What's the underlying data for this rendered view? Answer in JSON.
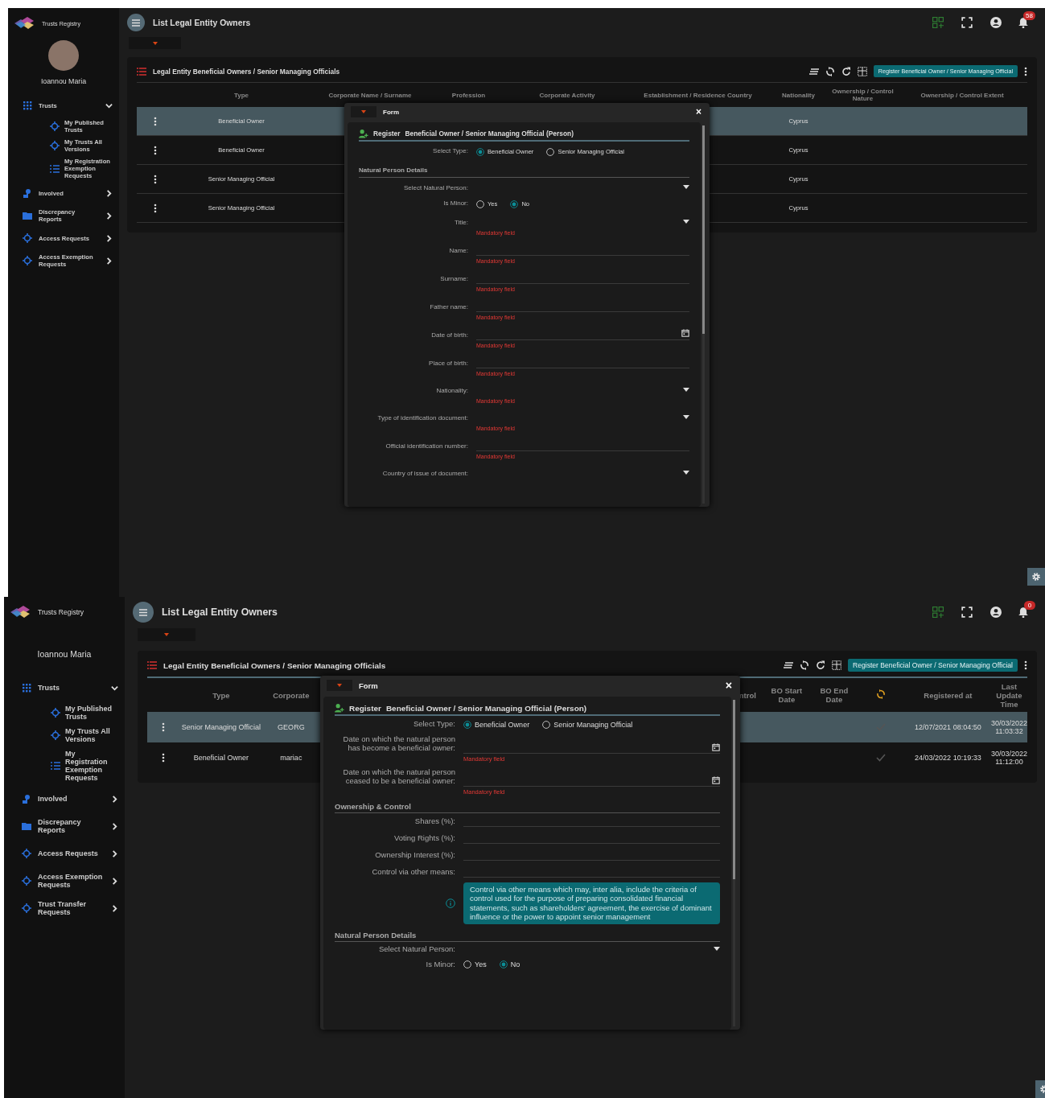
{
  "screens": [
    {
      "app_name": "Trusts Registry",
      "avatar": true,
      "user_name": "Ioannou Maria",
      "page_title": "List Legal Entity Owners",
      "notification_count": "58",
      "nav": [
        {
          "label": "Trusts",
          "kind": "grid",
          "expanded": true,
          "children": [
            {
              "label": "My Published Trusts",
              "kind": "target"
            },
            {
              "label": "My Trusts All Versions",
              "kind": "target"
            },
            {
              "label": "My Registration Exemption Requests",
              "kind": "list"
            }
          ]
        },
        {
          "label": "Involved",
          "kind": "person",
          "expanded": false
        },
        {
          "label": "Discrepancy Reports",
          "kind": "folder",
          "expanded": false
        },
        {
          "label": "Access Requests",
          "kind": "target",
          "expanded": false
        },
        {
          "label": "Access Exemption Requests",
          "kind": "target",
          "expanded": false
        }
      ],
      "table": {
        "title": "Legal Entity Beneficial Owners / Senior Managing Officials",
        "button": "Register Beneficial Owner / Senior Managing Official",
        "columns": [
          {
            "kind": "text",
            "label": "Type"
          },
          {
            "kind": "text",
            "label": "Corporate Name / Surname"
          },
          {
            "kind": "text",
            "label": "Profession"
          },
          {
            "kind": "text",
            "label": "Corporate Activity"
          },
          {
            "kind": "text",
            "label": "Establishment / Residence Country"
          },
          {
            "kind": "text",
            "label": "Nationality"
          },
          {
            "kind": "text",
            "label": "Ownership / Control Nature"
          },
          {
            "kind": "text",
            "label": "Ownership / Control Extent"
          }
        ],
        "rows": [
          {
            "selected": true,
            "cells": [
              "Beneficial Owner",
              null,
              null,
              null,
              null,
              "Cyprus",
              null,
              null
            ]
          },
          {
            "selected": false,
            "cells": [
              "Beneficial Owner",
              null,
              null,
              null,
              null,
              "Cyprus",
              null,
              null
            ]
          },
          {
            "selected": false,
            "cells": [
              "Senior Managing Official",
              null,
              null,
              null,
              null,
              "Cyprus",
              null,
              null
            ]
          },
          {
            "selected": false,
            "cells": [
              "Senior Managing Official",
              null,
              null,
              null,
              null,
              "Cyprus",
              null,
              null
            ]
          }
        ]
      },
      "form": {
        "title": "Form",
        "close": "×",
        "heading_prefix": "Register",
        "heading": "Beneficial Owner / Senior Managing Official (Person)",
        "fields": [
          {
            "kind": "radio",
            "label": "Select Type:",
            "options": [
              {
                "label": "Beneficial Owner",
                "selected": true
              },
              {
                "label": "Senior Managing Official",
                "selected": false
              }
            ]
          },
          {
            "kind": "section",
            "label": "Natural Person Details"
          },
          {
            "kind": "select",
            "label": "Select Natural Person:"
          },
          {
            "kind": "radio",
            "label": "Is Minor:",
            "options": [
              {
                "label": "Yes",
                "selected": false
              },
              {
                "label": "No",
                "selected": true
              }
            ]
          },
          {
            "kind": "select",
            "label": "Title:",
            "error": "Mandatory field"
          },
          {
            "kind": "text",
            "label": "Name:",
            "error": "Mandatory field"
          },
          {
            "kind": "text",
            "label": "Surname:",
            "error": "Mandatory field"
          },
          {
            "kind": "text",
            "label": "Father name:",
            "error": "Mandatory field"
          },
          {
            "kind": "date",
            "label": "Date of birth:",
            "error": "Mandatory field"
          },
          {
            "kind": "text",
            "label": "Place of birth:",
            "error": "Mandatory field"
          },
          {
            "kind": "select",
            "label": "Nationality:",
            "error": "Mandatory field"
          },
          {
            "kind": "select",
            "label": "Type of identification document:",
            "error": "Mandatory field"
          },
          {
            "kind": "text",
            "label": "Official identification number:",
            "error": "Mandatory field"
          },
          {
            "kind": "select",
            "label": "Country of issue of document:"
          }
        ]
      }
    },
    {
      "app_name": "Trusts Registry",
      "avatar": false,
      "user_name": "Ioannou Maria",
      "page_title": "List Legal Entity Owners",
      "notification_count": "0",
      "nav": [
        {
          "label": "Trusts",
          "kind": "grid",
          "expanded": true,
          "children": [
            {
              "label": "My Published Trusts",
              "kind": "target"
            },
            {
              "label": "My Trusts All Versions",
              "kind": "target"
            },
            {
              "label": "My Registration Exemption Requests",
              "kind": "list"
            }
          ]
        },
        {
          "label": "Involved",
          "kind": "person",
          "expanded": false
        },
        {
          "label": "Discrepancy Reports",
          "kind": "folder",
          "expanded": false
        },
        {
          "label": "Access Requests",
          "kind": "target",
          "expanded": false
        },
        {
          "label": "Access Exemption Requests",
          "kind": "target",
          "expanded": false
        },
        {
          "label": "Trust Transfer Requests",
          "kind": "target",
          "expanded": false
        }
      ],
      "table": {
        "title": "Legal Entity Beneficial Owners / Senior Managing Officials",
        "button": "Register Beneficial Owner / Senior Managing Official",
        "columns": [
          {
            "kind": "text",
            "label": "Type"
          },
          {
            "kind": "text",
            "label": "Corporate"
          },
          {
            "kind": "covered"
          },
          {
            "kind": "text",
            "label": "ntrol"
          },
          {
            "kind": "text",
            "label": "BO Start Date"
          },
          {
            "kind": "text",
            "label": "BO End Date"
          },
          {
            "kind": "sync-icon"
          },
          {
            "kind": "text",
            "label": "Registered at"
          },
          {
            "kind": "text",
            "label": "Last Update Time"
          }
        ],
        "rows": [
          {
            "selected": true,
            "cells": [
              "Senior Managing Official",
              "GEORG",
              null,
              null,
              null,
              null,
              {
                "checked": true
              },
              "12/07/2021 08:04:50",
              "30/03/2022 11:03:32"
            ]
          },
          {
            "selected": false,
            "cells": [
              "Beneficial Owner",
              "mariac",
              null,
              null,
              null,
              null,
              {
                "checked": true
              },
              "24/03/2022 10:19:33",
              "30/03/2022 11:12:00"
            ]
          }
        ]
      },
      "form": {
        "title": "Form",
        "close": "×",
        "heading_prefix": "Register",
        "heading": "Beneficial Owner / Senior Managing Official (Person)",
        "fields": [
          {
            "kind": "radio",
            "label": "Select Type:",
            "options": [
              {
                "label": "Beneficial Owner",
                "selected": true
              },
              {
                "label": "Senior Managing Official",
                "selected": false
              }
            ]
          },
          {
            "kind": "date",
            "label": "Date on which the natural person has become a beneficial owner:",
            "error": "Mandatory field"
          },
          {
            "kind": "date",
            "label": "Date on which the natural person ceased to be a beneficial owner:",
            "error": "Mandatory field"
          },
          {
            "kind": "section",
            "label": "Ownership & Control"
          },
          {
            "kind": "text",
            "label": "Shares (%):"
          },
          {
            "kind": "text",
            "label": "Voting Rights (%):"
          },
          {
            "kind": "text",
            "label": "Ownership Interest (%):"
          },
          {
            "kind": "text",
            "label": "Control via other means:"
          },
          {
            "kind": "info",
            "text": "Control via other means which may, inter alia, include the criteria of control used for the purpose of preparing consolidated financial statements, such as shareholders' agreement, the exercise of dominant influence or the power to appoint senior management"
          },
          {
            "kind": "section",
            "label": "Natural Person Details"
          },
          {
            "kind": "select",
            "label": "Select Natural Person:"
          },
          {
            "kind": "radio",
            "label": "Is Minor:",
            "options": [
              {
                "label": "Yes",
                "selected": false
              },
              {
                "label": "No",
                "selected": true
              }
            ]
          }
        ]
      }
    }
  ]
}
